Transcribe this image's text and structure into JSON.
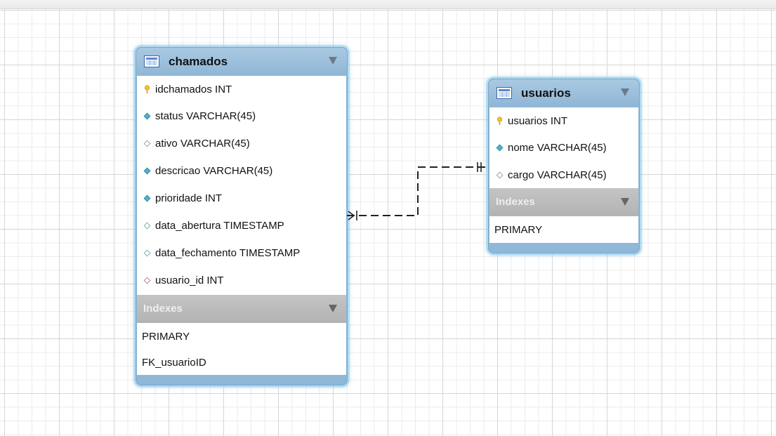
{
  "tables": {
    "chamados": {
      "title": "chamados",
      "columns": [
        {
          "label": "idchamados INT",
          "icon": "primary-key-icon"
        },
        {
          "label": "status VARCHAR(45)",
          "icon": "not-null-column-icon"
        },
        {
          "label": "ativo VARCHAR(45)",
          "icon": "nullable-column-icon"
        },
        {
          "label": "descricao VARCHAR(45)",
          "icon": "not-null-column-icon"
        },
        {
          "label": "prioridade INT",
          "icon": "not-null-column-icon"
        },
        {
          "label": "data_abertura TIMESTAMP",
          "icon": "nullable-column-icon"
        },
        {
          "label": "data_fechamento TIMESTAMP",
          "icon": "nullable-column-icon"
        },
        {
          "label": "usuario_id INT",
          "icon": "foreign-key-column-icon"
        }
      ],
      "indexes_label": "Indexes",
      "indexes": [
        "PRIMARY",
        "FK_usuarioID"
      ]
    },
    "usuarios": {
      "title": "usuarios",
      "columns": [
        {
          "label": "usuarios INT",
          "icon": "primary-key-icon"
        },
        {
          "label": "nome VARCHAR(45)",
          "icon": "not-null-column-icon"
        },
        {
          "label": "cargo VARCHAR(45)",
          "icon": "nullable-column-icon"
        }
      ],
      "indexes_label": "Indexes",
      "indexes": [
        "PRIMARY"
      ]
    }
  },
  "relationship": {
    "from_table": "chamados",
    "to_table": "usuarios",
    "from_end": "many-optional",
    "to_end": "one-mandatory",
    "line_style": "dashed"
  },
  "colors": {
    "table_header": "#9ec1df",
    "table_glow": "#96cdeb",
    "indexes_header": "#bdbdbd",
    "key_icon": "#f2c230",
    "not_null_diamond": "#4fb3cc",
    "fk_diamond_outline": "#c8838a",
    "relationship_line": "#222222"
  }
}
